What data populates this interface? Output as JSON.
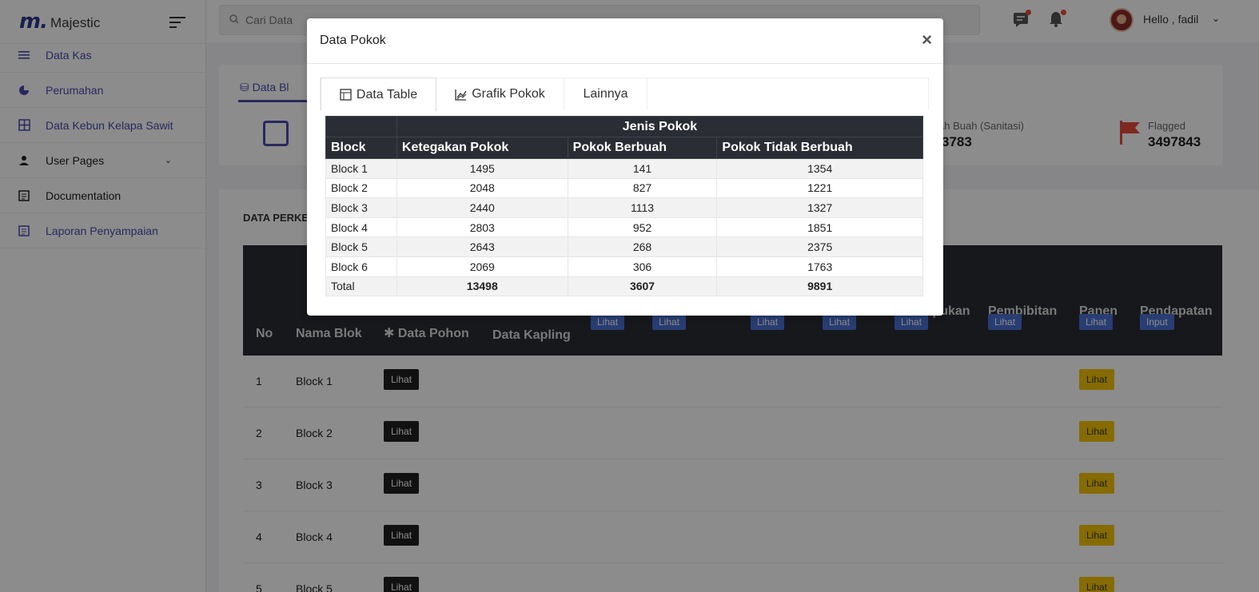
{
  "brand": {
    "logo": "m.",
    "name": "Majestic"
  },
  "sidebar": {
    "items": [
      {
        "label": "Data Kas",
        "icon": "list-icon"
      },
      {
        "label": "Perumahan",
        "icon": "pie-icon"
      },
      {
        "label": "Data Kebun Kelapa Sawit",
        "icon": "grid-icon"
      },
      {
        "label": "User Pages",
        "icon": "person-icon"
      },
      {
        "label": "Documentation",
        "icon": "document-icon"
      },
      {
        "label": "Laporan Penyampaian",
        "icon": "document-icon"
      }
    ]
  },
  "topbar": {
    "search_placeholder": "Cari Data",
    "greeting": "Hello , fadil"
  },
  "main": {
    "tab_label": "Data Bl",
    "stat_1_label": "ah Buah (Sanitasi)",
    "stat_1_value": "3783",
    "stat_2_label": "Flagged",
    "stat_2_value": "3497843",
    "section_title": "DATA PERKE",
    "headers": {
      "no": "No",
      "nama_blok": "Nama Blok",
      "data_pohon": "Data Pohon",
      "data_kapling": "Data Kapling",
      "pembibitan": "Pembibitan",
      "panen": "Panen",
      "pendapatan": "Pendapatan",
      "col_a_partial": "ıpukan",
      "lihat": "Lihat",
      "input": "Input"
    },
    "rows": [
      {
        "no": "1",
        "nama": "Block 1"
      },
      {
        "no": "2",
        "nama": "Block 2"
      },
      {
        "no": "3",
        "nama": "Block 3"
      },
      {
        "no": "4",
        "nama": "Block 4"
      },
      {
        "no": "5",
        "nama": "Block 5"
      }
    ],
    "row_button": "Lihat"
  },
  "modal": {
    "title": "Data Pokok",
    "close": "×",
    "tabs": [
      {
        "label": "Data Table"
      },
      {
        "label": "Grafik Pokok"
      },
      {
        "label": "Lainnya"
      }
    ],
    "table": {
      "group_header": "Jenis Pokok",
      "col_block": "Block",
      "col_1": "Ketegakan Pokok",
      "col_2": "Pokok Berbuah",
      "col_3": "Pokok Tidak Berbuah",
      "rows": [
        {
          "block": "Block 1",
          "a": "1495",
          "b": "141",
          "c": "1354"
        },
        {
          "block": "Block 2",
          "a": "2048",
          "b": "827",
          "c": "1221"
        },
        {
          "block": "Block 3",
          "a": "2440",
          "b": "1113",
          "c": "1327"
        },
        {
          "block": "Block 4",
          "a": "2803",
          "b": "952",
          "c": "1851"
        },
        {
          "block": "Block 5",
          "a": "2643",
          "b": "268",
          "c": "2375"
        },
        {
          "block": "Block 6",
          "a": "2069",
          "b": "306",
          "c": "1763"
        }
      ],
      "total": {
        "block": "Total",
        "a": "13498",
        "b": "3607",
        "c": "9891"
      }
    }
  },
  "colors": {
    "accent": "#4b49ac",
    "header_dark": "#2b2d34",
    "warning": "#f5c400",
    "danger": "#e74a3b"
  }
}
